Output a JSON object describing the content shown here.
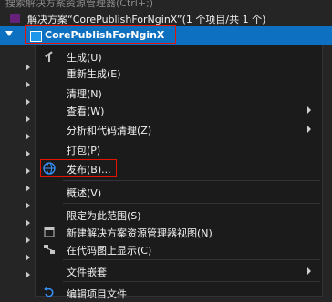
{
  "search": {
    "placeholder": "搜索解决方案资源管理器(Ctrl+;)"
  },
  "solution": {
    "label": "解决方案“CorePublishForNginX”(1 个项目/共 1 个)"
  },
  "project": {
    "name": "CorePublishForNginX"
  },
  "menu": {
    "build": "生成(U)",
    "rebuild": "重新生成(E)",
    "clean": "清理(N)",
    "view": "查看(W)",
    "analyze": "分析和代码清理(Z)",
    "pack": "打包(P)",
    "publish": "发布(B)...",
    "overview": "概述(V)",
    "scope": "限定为此范围(S)",
    "new_view": "新建解决方案资源管理器视图(N)",
    "code_map": "在代码图上显示(C)",
    "file_nesting": "文件嵌套",
    "edit_project": "编辑项目文件"
  },
  "colors": {
    "selection": "#0e70c0",
    "highlight_border": "#e51400",
    "menu_bg": "#1b1b1c"
  }
}
